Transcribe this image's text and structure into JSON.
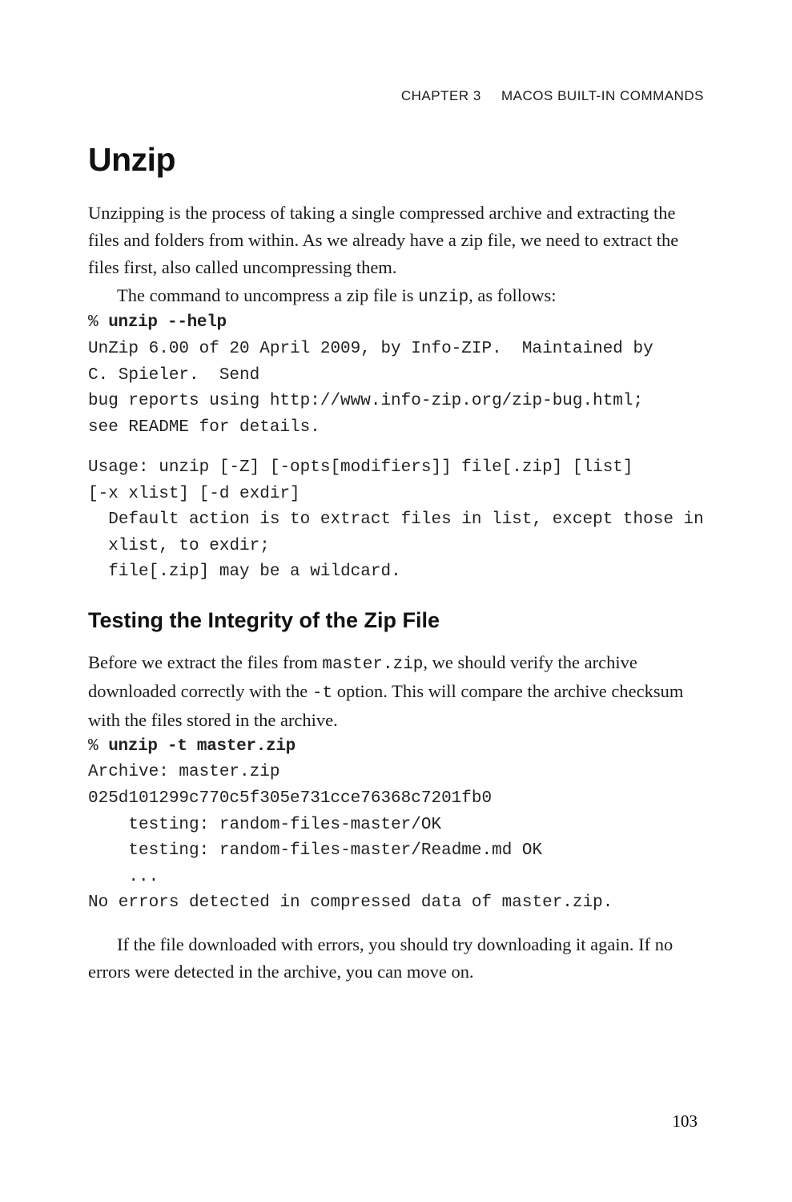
{
  "header": {
    "chapter_label": "CHAPTER 3",
    "chapter_title": "MACOS BUILT-IN COMMANDS"
  },
  "section": {
    "title": "Unzip",
    "para1a": "Unzipping is the process of taking a single compressed archive and extracting the files and folders from within. As we already have a zip file, we need to extract the files first, also called uncompressing them.",
    "para1b_pre": "The command to uncompress a zip file is ",
    "para1b_code": "unzip",
    "para1b_post": ", as follows:"
  },
  "code1": {
    "prompt": "% ",
    "cmd": "unzip --help",
    "l1": "UnZip 6.00 of 20 April 2009, by Info-ZIP.  Maintained by ",
    "l2": "C. Spieler.  Send",
    "l3": "bug reports using http://www.info-zip.org/zip-bug.html; ",
    "l4": "see README for details."
  },
  "code1b": {
    "l1": "Usage: unzip [-Z] [-opts[modifiers]] file[.zip] [list] ",
    "l2": "[-x xlist] [-d exdir]",
    "l3": "  Default action is to extract files in list, except those in ",
    "l4": "  xlist, to exdir;",
    "l5": "  file[.zip] may be a wildcard."
  },
  "subsection": {
    "title": "Testing the Integrity of the Zip File",
    "para_pre": "Before we extract the files from ",
    "para_code1": "master.zip",
    "para_mid": ", we should verify the archive downloaded correctly with the ",
    "para_code2": "-t",
    "para_post": " option. This will compare the archive checksum with the files stored in the archive."
  },
  "code2": {
    "prompt": "% ",
    "cmd": "unzip -t master.zip",
    "l1": "Archive: master.zip",
    "l2": "025d101299c770c5f305e731cce76368c7201fb0",
    "l3": "    testing: random-files-master/OK",
    "l4": "    testing: random-files-master/Readme.md OK",
    "l5": "    ...",
    "l6": "No errors detected in compressed data of master.zip."
  },
  "closing": {
    "p1": "If the file downloaded with errors, you should try downloading it again. If no errors were detected in the archive, you can move on."
  },
  "page_number": "103"
}
